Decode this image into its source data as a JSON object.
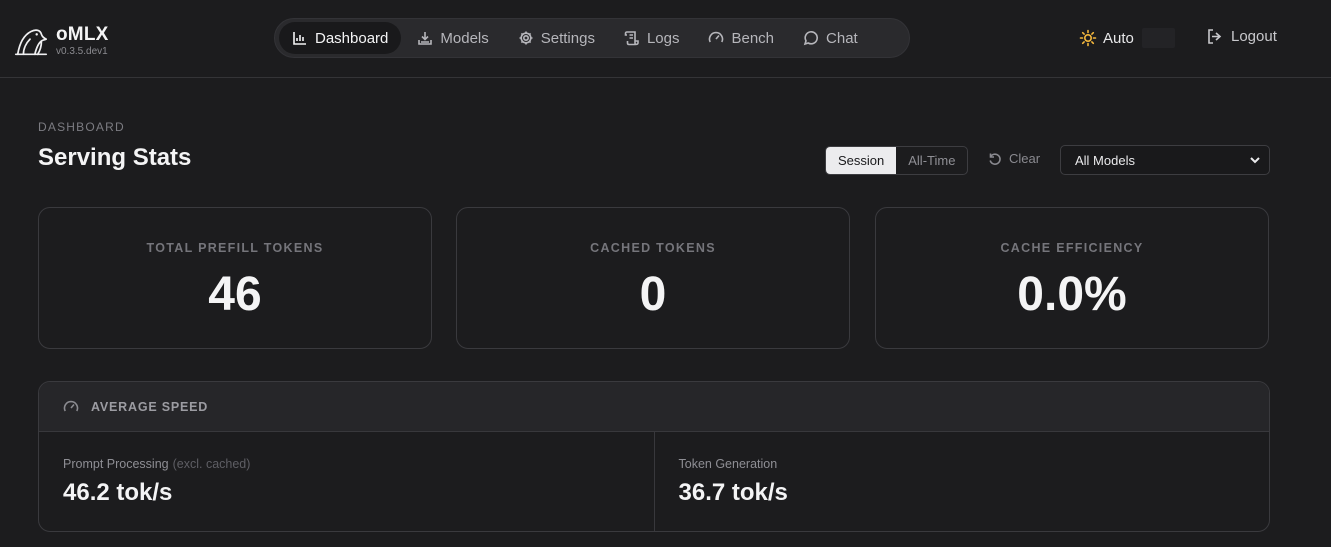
{
  "brand": {
    "name": "oMLX",
    "version": "v0.3.5.dev1"
  },
  "nav": {
    "items": [
      {
        "label": "Dashboard",
        "icon": "bar-chart-icon",
        "active": true
      },
      {
        "label": "Models",
        "icon": "download-icon",
        "active": false
      },
      {
        "label": "Settings",
        "icon": "gear-icon",
        "active": false
      },
      {
        "label": "Logs",
        "icon": "scroll-icon",
        "active": false
      },
      {
        "label": "Bench",
        "icon": "gauge-icon",
        "active": false
      },
      {
        "label": "Chat",
        "icon": "chat-bubble-icon",
        "active": false
      }
    ]
  },
  "theme": {
    "label": "Auto",
    "icon": "sun-icon"
  },
  "logout": {
    "label": "Logout",
    "icon": "logout-icon"
  },
  "header": {
    "breadcrumb": "DASHBOARD",
    "title": "Serving Stats"
  },
  "controls": {
    "scope": {
      "options": [
        "Session",
        "All-Time"
      ],
      "selected": "Session"
    },
    "clear_label": "Clear",
    "model_select": {
      "value": "All Models"
    }
  },
  "stats": [
    {
      "label": "TOTAL PREFILL TOKENS",
      "value": "46"
    },
    {
      "label": "CACHED TOKENS",
      "value": "0"
    },
    {
      "label": "CACHE EFFICIENCY",
      "value": "0.0%"
    }
  ],
  "average_speed": {
    "title": "AVERAGE SPEED",
    "prompt": {
      "label": "Prompt Processing",
      "sublabel": "(excl. cached)",
      "value": "46.2 tok/s"
    },
    "generation": {
      "label": "Token Generation",
      "value": "36.7 tok/s"
    }
  },
  "colors": {
    "background": "#1c1c1e",
    "card_border": "#3a3a3e",
    "accent_sun": "#f5b83d"
  }
}
